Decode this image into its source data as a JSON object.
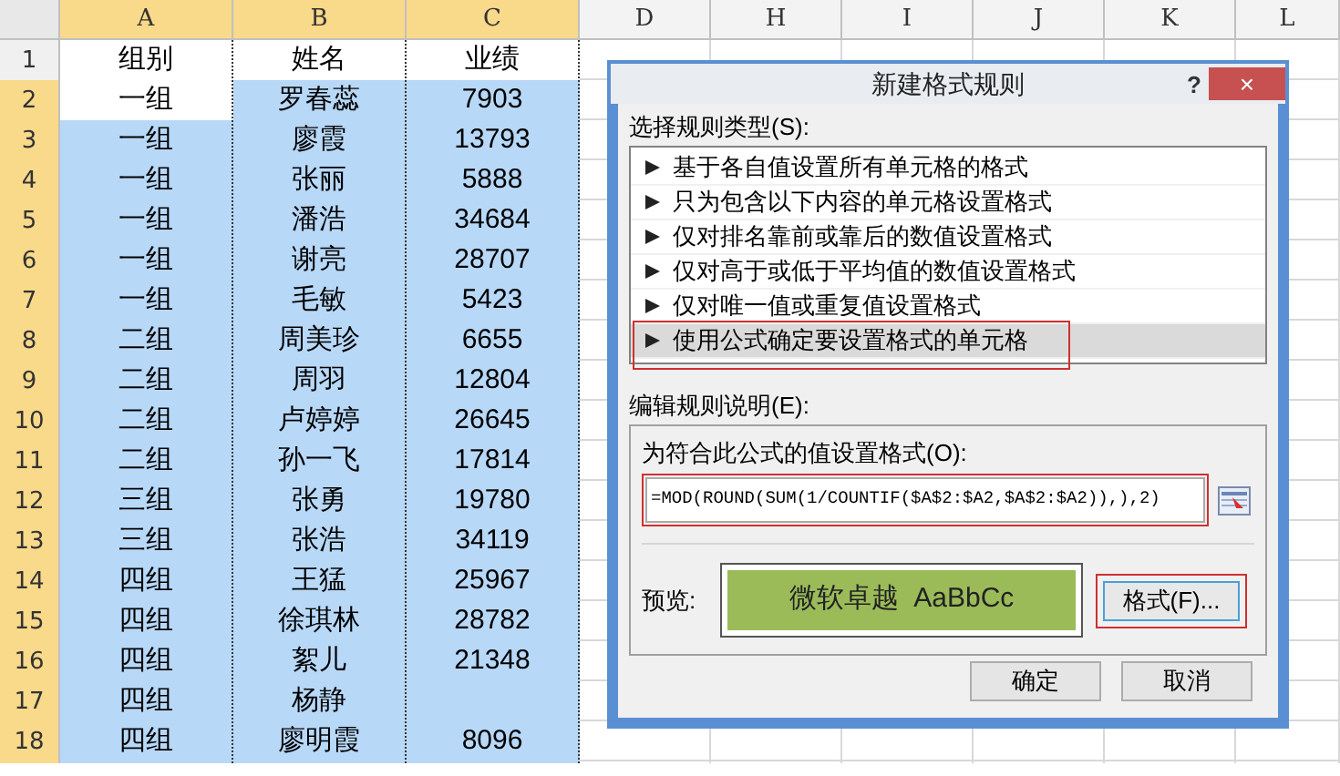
{
  "spreadsheet": {
    "columns": [
      {
        "label": "A",
        "selected": true
      },
      {
        "label": "B",
        "selected": true
      },
      {
        "label": "C",
        "selected": true
      },
      {
        "label": "D",
        "selected": false
      },
      {
        "label": "H",
        "selected": false
      },
      {
        "label": "I",
        "selected": false
      },
      {
        "label": "J",
        "selected": false
      },
      {
        "label": "K",
        "selected": false
      },
      {
        "label": "L",
        "selected": false
      }
    ],
    "rows": [
      {
        "number": "1",
        "selected": false,
        "cells": [
          {
            "text": "组别",
            "selected": false
          },
          {
            "text": "姓名",
            "selected": false
          },
          {
            "text": "业绩",
            "selected": false
          }
        ]
      },
      {
        "number": "2",
        "selected": true,
        "cells": [
          {
            "text": "一组",
            "selected": false
          },
          {
            "text": "罗春蕊",
            "selected": true
          },
          {
            "text": "7903",
            "selected": true
          }
        ]
      },
      {
        "number": "3",
        "selected": true,
        "cells": [
          {
            "text": "一组",
            "selected": true
          },
          {
            "text": "廖霞",
            "selected": true
          },
          {
            "text": "13793",
            "selected": true
          }
        ]
      },
      {
        "number": "4",
        "selected": true,
        "cells": [
          {
            "text": "一组",
            "selected": true
          },
          {
            "text": "张丽",
            "selected": true
          },
          {
            "text": "5888",
            "selected": true
          }
        ]
      },
      {
        "number": "5",
        "selected": true,
        "cells": [
          {
            "text": "一组",
            "selected": true
          },
          {
            "text": "潘浩",
            "selected": true
          },
          {
            "text": "34684",
            "selected": true
          }
        ]
      },
      {
        "number": "6",
        "selected": true,
        "cells": [
          {
            "text": "一组",
            "selected": true
          },
          {
            "text": "谢亮",
            "selected": true
          },
          {
            "text": "28707",
            "selected": true
          }
        ]
      },
      {
        "number": "7",
        "selected": true,
        "cells": [
          {
            "text": "一组",
            "selected": true
          },
          {
            "text": "毛敏",
            "selected": true
          },
          {
            "text": "5423",
            "selected": true
          }
        ]
      },
      {
        "number": "8",
        "selected": true,
        "cells": [
          {
            "text": "二组",
            "selected": true
          },
          {
            "text": "周美珍",
            "selected": true
          },
          {
            "text": "6655",
            "selected": true
          }
        ]
      },
      {
        "number": "9",
        "selected": true,
        "cells": [
          {
            "text": "二组",
            "selected": true
          },
          {
            "text": "周羽",
            "selected": true
          },
          {
            "text": "12804",
            "selected": true
          }
        ]
      },
      {
        "number": "10",
        "selected": true,
        "cells": [
          {
            "text": "二组",
            "selected": true
          },
          {
            "text": "卢婷婷",
            "selected": true
          },
          {
            "text": "26645",
            "selected": true
          }
        ]
      },
      {
        "number": "11",
        "selected": true,
        "cells": [
          {
            "text": "二组",
            "selected": true
          },
          {
            "text": "孙一飞",
            "selected": true
          },
          {
            "text": "17814",
            "selected": true
          }
        ]
      },
      {
        "number": "12",
        "selected": true,
        "cells": [
          {
            "text": "三组",
            "selected": true
          },
          {
            "text": "张勇",
            "selected": true
          },
          {
            "text": "19780",
            "selected": true
          }
        ]
      },
      {
        "number": "13",
        "selected": true,
        "cells": [
          {
            "text": "三组",
            "selected": true
          },
          {
            "text": "张浩",
            "selected": true
          },
          {
            "text": "34119",
            "selected": true
          }
        ]
      },
      {
        "number": "14",
        "selected": true,
        "cells": [
          {
            "text": "四组",
            "selected": true
          },
          {
            "text": "王猛",
            "selected": true
          },
          {
            "text": "25967",
            "selected": true
          }
        ]
      },
      {
        "number": "15",
        "selected": true,
        "cells": [
          {
            "text": "四组",
            "selected": true
          },
          {
            "text": "徐琪林",
            "selected": true
          },
          {
            "text": "28782",
            "selected": true
          }
        ]
      },
      {
        "number": "16",
        "selected": true,
        "cells": [
          {
            "text": "四组",
            "selected": true
          },
          {
            "text": "絮儿",
            "selected": true
          },
          {
            "text": "21348",
            "selected": true
          }
        ]
      },
      {
        "number": "17",
        "selected": true,
        "cells": [
          {
            "text": "四组",
            "selected": true
          },
          {
            "text": "杨静",
            "selected": true
          },
          {
            "selected": true
          }
        ]
      },
      {
        "number": "18",
        "selected": true,
        "cells": [
          {
            "text": "四组",
            "selected": true
          },
          {
            "text": "廖明霞",
            "selected": true
          },
          {
            "text": "8096",
            "selected": true
          }
        ]
      }
    ]
  },
  "dialog": {
    "title": "新建格式规则",
    "help": "?",
    "close": "×",
    "rule_type_label": "选择规则类型(S):",
    "rule_types": [
      {
        "label": "基于各自值设置所有单元格的格式",
        "selected": false
      },
      {
        "label": "只为包含以下内容的单元格设置格式",
        "selected": false
      },
      {
        "label": "仅对排名靠前或靠后的数值设置格式",
        "selected": false
      },
      {
        "label": "仅对高于或低于平均值的数值设置格式",
        "selected": false
      },
      {
        "label": "仅对唯一值或重复值设置格式",
        "selected": false
      },
      {
        "label": "使用公式确定要设置格式的单元格",
        "selected": true
      }
    ],
    "edit_label": "编辑规则说明(E):",
    "formula_label": "为符合此公式的值设置格式(O):",
    "formula": "=MOD(ROUND(SUM(1/COUNTIF($A$2:$A2,$A$2:$A2)),),2)",
    "preview_label": "预览:",
    "preview_text": "微软卓越  AaBbCc",
    "format_button": "格式(F)...",
    "buttons": [
      "确定",
      "取消"
    ]
  }
}
